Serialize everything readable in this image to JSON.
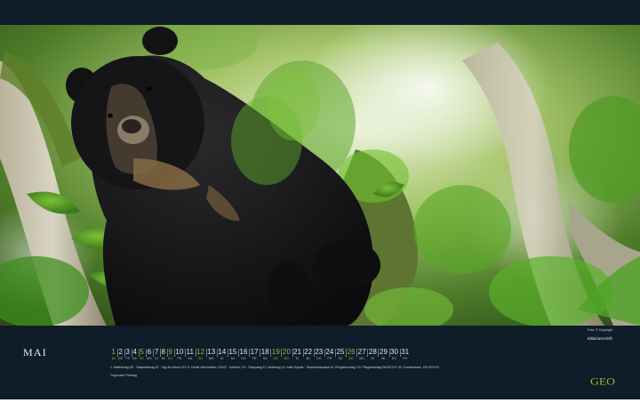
{
  "calendar": {
    "month": "MAI",
    "days": [
      {
        "num": "1",
        "wd": "MI",
        "hl": true
      },
      {
        "num": "2",
        "wd": "DO",
        "hl": false
      },
      {
        "num": "3",
        "wd": "FR",
        "hl": false
      },
      {
        "num": "4",
        "wd": "SA",
        "hl": false
      },
      {
        "num": "5",
        "wd": "SO",
        "hl": true
      },
      {
        "num": "6",
        "wd": "MO",
        "hl": false
      },
      {
        "num": "7",
        "wd": "DI",
        "hl": false
      },
      {
        "num": "8",
        "wd": "MI",
        "hl": false
      },
      {
        "num": "9",
        "wd": "DO",
        "hl": true
      },
      {
        "num": "10",
        "wd": "FR",
        "hl": false
      },
      {
        "num": "11",
        "wd": "SA",
        "hl": false
      },
      {
        "num": "12",
        "wd": "SO",
        "hl": true
      },
      {
        "num": "13",
        "wd": "MO",
        "hl": false
      },
      {
        "num": "14",
        "wd": "DI",
        "hl": false
      },
      {
        "num": "15",
        "wd": "MI",
        "hl": false
      },
      {
        "num": "16",
        "wd": "DO",
        "hl": false
      },
      {
        "num": "17",
        "wd": "FR",
        "hl": false
      },
      {
        "num": "18",
        "wd": "SA",
        "hl": false
      },
      {
        "num": "19",
        "wd": "SO",
        "hl": true
      },
      {
        "num": "20",
        "wd": "MO",
        "hl": true
      },
      {
        "num": "21",
        "wd": "DI",
        "hl": false
      },
      {
        "num": "22",
        "wd": "MI",
        "hl": false
      },
      {
        "num": "23",
        "wd": "DO",
        "hl": false
      },
      {
        "num": "24",
        "wd": "FR",
        "hl": false
      },
      {
        "num": "25",
        "wd": "SA",
        "hl": false
      },
      {
        "num": "26",
        "wd": "SO",
        "hl": true
      },
      {
        "num": "27",
        "wd": "MO",
        "hl": false
      },
      {
        "num": "28",
        "wd": "DI",
        "hl": false
      },
      {
        "num": "29",
        "wd": "MI",
        "hl": false
      },
      {
        "num": "30",
        "wd": "DO",
        "hl": false
      },
      {
        "num": "31",
        "wd": "FR",
        "hl": false
      }
    ],
    "holidays": "1. Maifeiertag DE · Staatsfeiertag AT · Tag der Arbeit CH*   9. Christi Himmelfahrt, DE/AT · Auffahrt, CH · Ecmpatag   12. Muttertag   13. Kalte Sophie · Skorbotskanaska   19. Pfingstsonntag*   20. Pfingstmontag DE/AT/CH*   30. Fronleichnam, DE*/AT/CH*",
    "holidays_note": "*regionaler Feiertag"
  },
  "credits": {
    "line1": "Foto: © Copyright",
    "line2": "Bildunterschrift"
  },
  "brand": {
    "logo_text": "GEO",
    "logo_color": "#8fbf3b"
  },
  "colors": {
    "panel": "#0f1d28",
    "highlight": "#8fbf3b",
    "text": "#e3e8eb"
  }
}
